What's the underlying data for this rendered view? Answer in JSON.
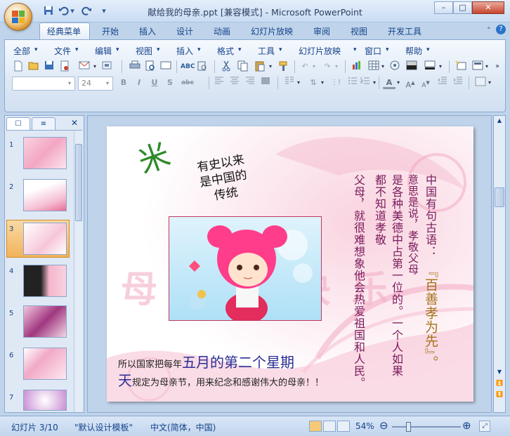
{
  "window": {
    "title": "献给我的母亲.ppt [兼容模式] - Microsoft PowerPoint",
    "minimize": "–",
    "maximize": "□",
    "close": "✕"
  },
  "quick_access": [
    "save-icon",
    "undo-icon",
    "redo-icon",
    "customize-icon"
  ],
  "ribbon_tabs": [
    "经典菜单",
    "开始",
    "插入",
    "设计",
    "动画",
    "幻灯片放映",
    "审阅",
    "视图",
    "开发工具"
  ],
  "active_tab": "经典菜单",
  "menus": [
    "全部",
    "文件",
    "编辑",
    "视图",
    "插入",
    "格式",
    "工具",
    "幻灯片放映",
    "窗口",
    "帮助"
  ],
  "font": {
    "name": "",
    "size": "24"
  },
  "format_buttons": {
    "bold": "B",
    "italic": "I",
    "underline": "U",
    "shadow": "S",
    "strike": "abc"
  },
  "slides_panel": {
    "tab_outline": "☐",
    "tab_slides": "≡",
    "close": "✕",
    "thumbnails": [
      "1",
      "2",
      "3",
      "4",
      "5",
      "6",
      "7"
    ],
    "selected": "3"
  },
  "slide": {
    "caption": "有史以来\n是中国的\n传统",
    "line1_prefix": "所以国家把每年",
    "line1_emph": "五月的第二个星期",
    "line2_emph": "天",
    "line2_rest": "规定为母亲节，用来纪念和感谢伟大的母亲！！",
    "col1": "中国有句古语：",
    "col2": "『百善孝为先』。",
    "col3": "意思是说，孝敬父母",
    "col4": "是各种美德中占第一位的。一个人如果",
    "col5": "都不知道孝敬",
    "col6": "父母，就很难想象他会热爱祖国和人民。",
    "logo_glyph": "米",
    "bg_text": "母  亲  节  快  乐"
  },
  "status": {
    "slide": "幻灯片 3/10",
    "template": "\"默认设计模板\"",
    "language": "中文(简体，中国)",
    "zoom": "54%",
    "zoom_minus": "⊖",
    "zoom_plus": "⊕"
  },
  "colors": {
    "ribbon": "#dde8f5",
    "accent": "#15428b",
    "slide_text": "#7a1a5c",
    "emphasis": "#2b2e94"
  }
}
